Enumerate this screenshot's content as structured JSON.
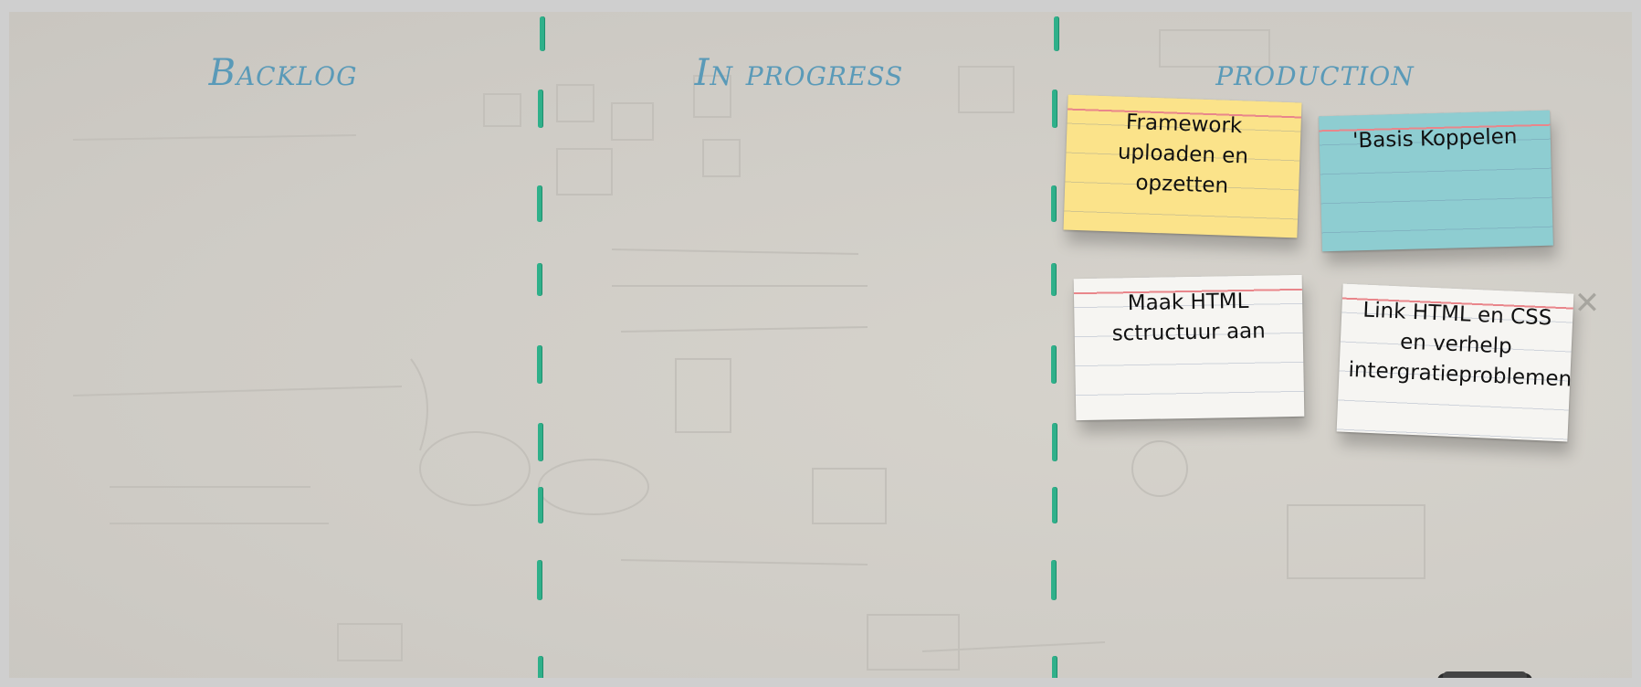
{
  "columns": [
    {
      "title": "Backlog"
    },
    {
      "title": "In progress"
    },
    {
      "title": "production"
    }
  ],
  "cards": [
    {
      "text": "Framework uploaden en opzetten",
      "color": "#fbe38a"
    },
    {
      "text": "'Basis Koppelen",
      "color": "#8ecdd1"
    },
    {
      "text": "Maak HTML sctructuur aan",
      "color": "#f6f5f2"
    },
    {
      "text": "Link HTML en CSS en verhelp intergratieproblemen",
      "color": "#f6f5f2"
    }
  ],
  "colors": {
    "title": "#5a9ab8",
    "divider": "#2fb08a"
  },
  "icons": {
    "close": "close-icon"
  }
}
